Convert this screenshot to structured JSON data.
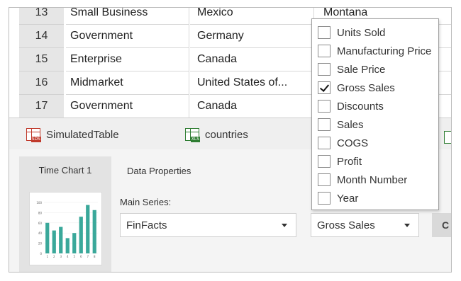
{
  "rows": [
    {
      "num": "13",
      "segment": "Small Business",
      "country": "Mexico",
      "product": "Montana"
    },
    {
      "num": "14",
      "segment": "Government",
      "country": "Germany",
      "product": ""
    },
    {
      "num": "15",
      "segment": "Enterprise",
      "country": "Canada",
      "product": ""
    },
    {
      "num": "16",
      "segment": "Midmarket",
      "country": "United States of...",
      "product": ""
    },
    {
      "num": "17",
      "segment": "Government",
      "country": "Canada",
      "product": ""
    }
  ],
  "tabs": [
    {
      "label": "SimulatedTable",
      "icon": "table-icon",
      "tag": "SDS"
    },
    {
      "label": "countries",
      "icon": "table-icon",
      "tag": "XLS"
    }
  ],
  "panel": {
    "side_title": "Time Chart 1",
    "props_title": "Data Properties",
    "main_series_label": "Main Series:",
    "main_series_value": "FinFacts",
    "measure_value": "Gross Sales",
    "edge_button_label": "C"
  },
  "thumbnail": {
    "bars": [
      0.6,
      0.45,
      0.52,
      0.3,
      0.4,
      0.72,
      0.95,
      0.85
    ],
    "y_ticks": [
      "100",
      "80",
      "60",
      "40",
      "20",
      "0"
    ],
    "x_ticks": [
      "1",
      "2",
      "3",
      "4",
      "5",
      "6",
      "7",
      "8"
    ],
    "bar_color": "#3aa89a"
  },
  "menu": {
    "options": [
      {
        "label": "Units Sold",
        "checked": false
      },
      {
        "label": "Manufacturing Price",
        "checked": false
      },
      {
        "label": "Sale Price",
        "checked": false
      },
      {
        "label": "Gross Sales",
        "checked": true
      },
      {
        "label": "Discounts",
        "checked": false
      },
      {
        "label": "Sales",
        "checked": false
      },
      {
        "label": "COGS",
        "checked": false
      },
      {
        "label": "Profit",
        "checked": false
      },
      {
        "label": "Month Number",
        "checked": false
      },
      {
        "label": "Year",
        "checked": false
      }
    ]
  }
}
